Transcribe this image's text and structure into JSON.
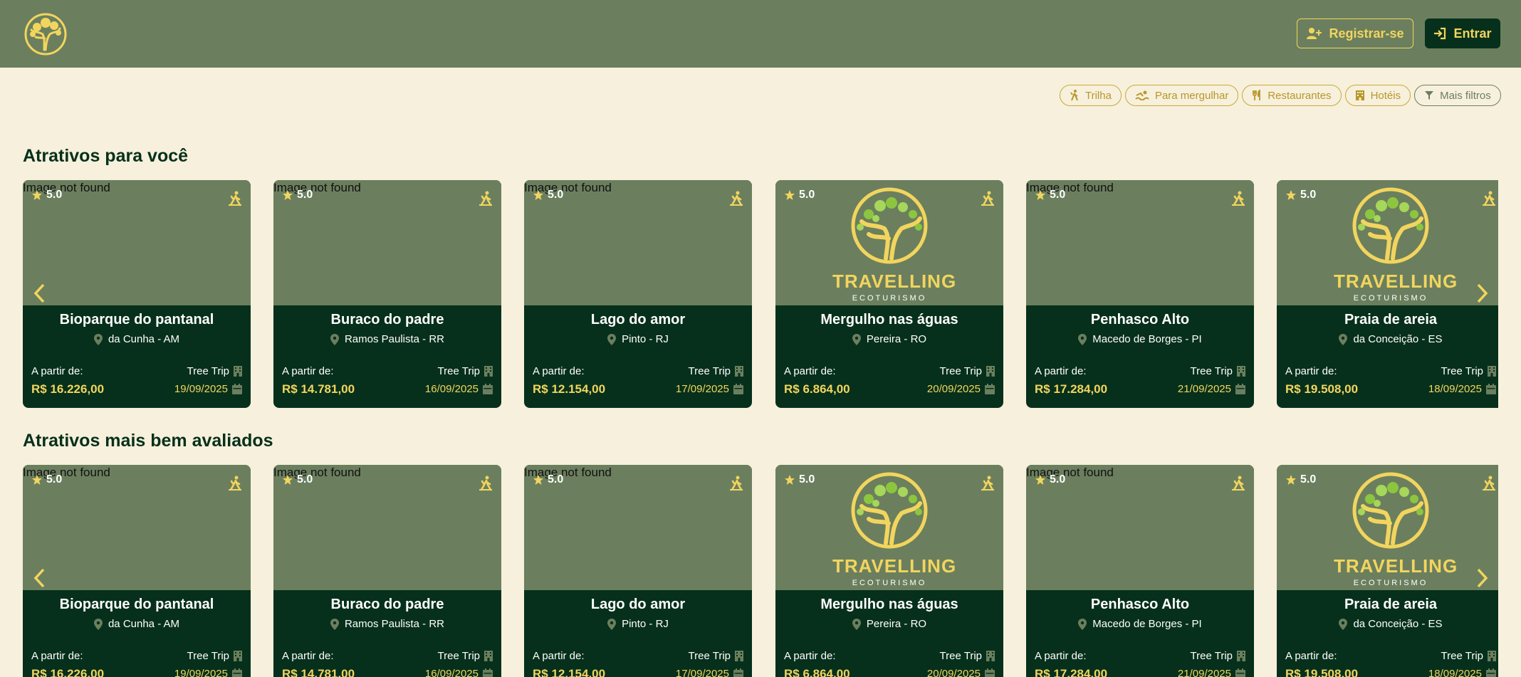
{
  "header": {
    "register_label": "Registrar-se",
    "login_label": "Entrar"
  },
  "filters": [
    {
      "label": "Trilha",
      "icon": "hiking-icon"
    },
    {
      "label": "Para mergulhar",
      "icon": "swimming-icon"
    },
    {
      "label": "Restaurantes",
      "icon": "utensils-icon"
    },
    {
      "label": "Hotéis",
      "icon": "hotel-icon"
    },
    {
      "label": "Mais filtros",
      "icon": "filter-icon"
    }
  ],
  "sections": [
    {
      "title": "Atrativos para você"
    },
    {
      "title": "Atrativos mais bem avaliados"
    }
  ],
  "brand": {
    "name": "TRAVELLING",
    "tagline": "ECOTURISMO"
  },
  "labels": {
    "img_alt": "Image not found",
    "from_price": "A partir de:"
  },
  "cards": [
    {
      "rating": "5.0",
      "title": "Bioparque do pantanal",
      "location": "da Cunha - AM",
      "price": "R$ 16.226,00",
      "provider": "Tree Trip",
      "date": "19/09/2025",
      "has_logo": false
    },
    {
      "rating": "5.0",
      "title": "Buraco do padre",
      "location": "Ramos Paulista - RR",
      "price": "R$ 14.781,00",
      "provider": "Tree Trip",
      "date": "16/09/2025",
      "has_logo": false
    },
    {
      "rating": "5.0",
      "title": "Lago do amor",
      "location": "Pinto - RJ",
      "price": "R$ 12.154,00",
      "provider": "Tree Trip",
      "date": "17/09/2025",
      "has_logo": false
    },
    {
      "rating": "5.0",
      "title": "Mergulho nas águas",
      "location": "Pereira - RO",
      "price": "R$ 6.864,00",
      "provider": "Tree Trip",
      "date": "20/09/2025",
      "has_logo": true
    },
    {
      "rating": "5.0",
      "title": "Penhasco Alto",
      "location": "Macedo de Borges - PI",
      "price": "R$ 17.284,00",
      "provider": "Tree Trip",
      "date": "21/09/2025",
      "has_logo": false
    },
    {
      "rating": "5.0",
      "title": "Praia de areia",
      "location": "da Conceição - ES",
      "price": "R$ 19.508,00",
      "provider": "Tree Trip",
      "date": "18/09/2025",
      "has_logo": true
    }
  ],
  "colors": {
    "header": "#6b7f5e",
    "background": "#f7f0dc",
    "card": "#06301b",
    "accent": "#f2d55e"
  }
}
